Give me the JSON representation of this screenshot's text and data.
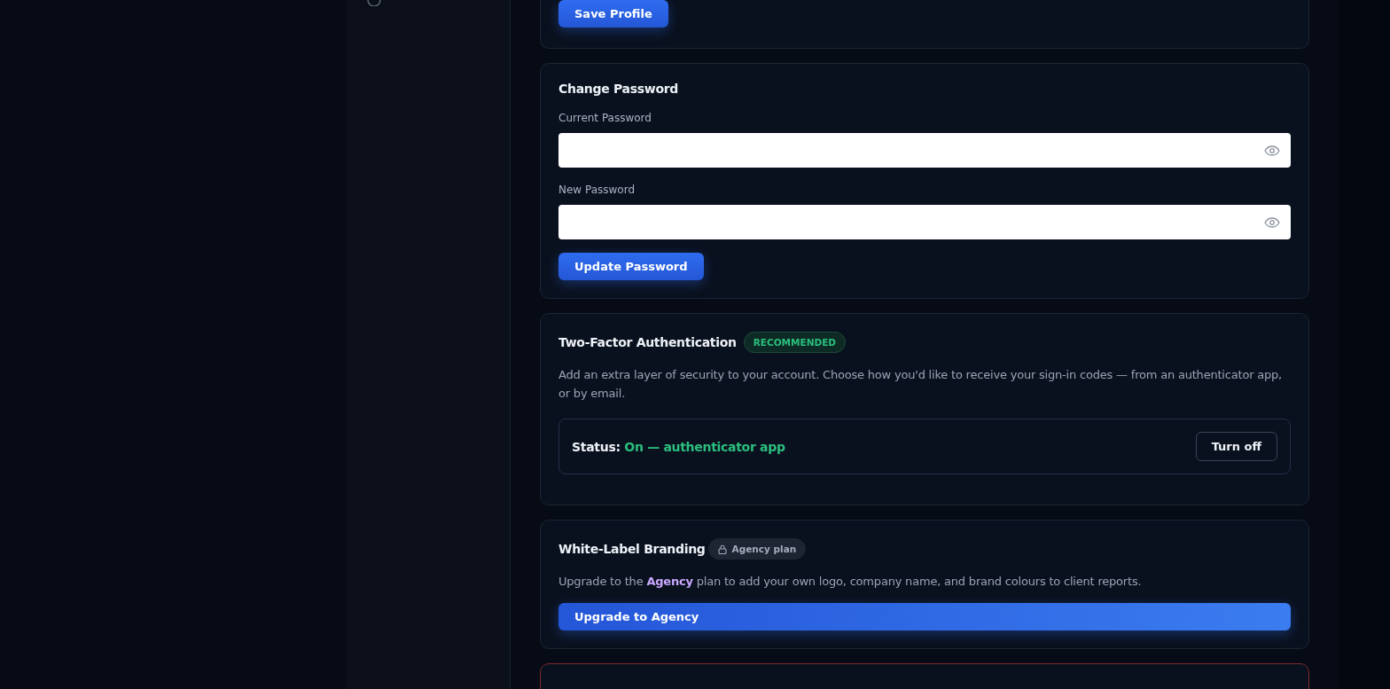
{
  "profile": {
    "save_button": "Save Profile"
  },
  "change_password": {
    "title": "Change Password",
    "fields": [
      {
        "label": "Current Password"
      },
      {
        "label": "New Password"
      }
    ],
    "button": "Update Password"
  },
  "two_factor": {
    "title": "Two-Factor Authentication",
    "badge": "RECOMMENDED",
    "description": "Add an extra layer of security to your account. Choose how you'd like to receive your sign-in codes — from an authenticator app, or by email.",
    "status_label": "Status:",
    "status_value": "On — authenticator app",
    "enabled": true,
    "button": "Turn off"
  },
  "white_label": {
    "title": "White-Label Branding",
    "badge": "Agency plan",
    "locked": true,
    "description": "Upgrade to the **Agency** plan to add your own logo, company name, and brand colours to client reports.",
    "button": "Upgrade to Agency"
  }
}
